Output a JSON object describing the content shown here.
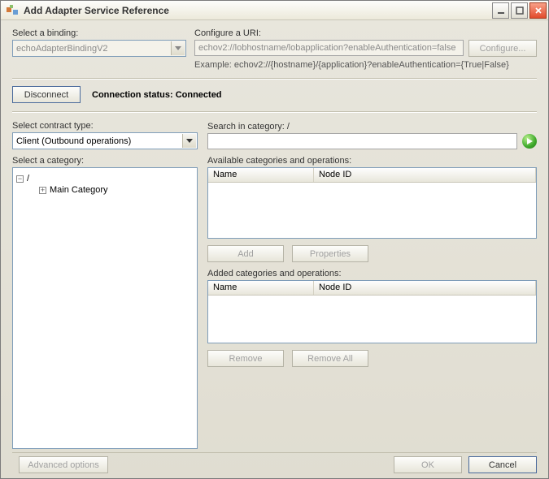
{
  "window": {
    "title": "Add Adapter Service Reference"
  },
  "binding": {
    "label": "Select a binding:",
    "value": "echoAdapterBindingV2"
  },
  "uri": {
    "label": "Configure a URI:",
    "value": "echov2://lobhostname/lobapplication?enableAuthentication=false",
    "configure_btn": "Configure...",
    "example": "Example: echov2://{hostname}/{application}?enableAuthentication={True|False}"
  },
  "connection": {
    "disconnect_btn": "Disconnect",
    "status_label": "Connection status:",
    "status_value": "Connected"
  },
  "contract": {
    "label": "Select contract type:",
    "value": "Client (Outbound operations)"
  },
  "search": {
    "label": "Search in category: /",
    "value": ""
  },
  "category": {
    "label": "Select a category:",
    "root": "/",
    "child": "Main Category"
  },
  "available": {
    "label": "Available categories and operations:",
    "col_name": "Name",
    "col_node": "Node ID",
    "add_btn": "Add",
    "props_btn": "Properties"
  },
  "added": {
    "label": "Added categories and operations:",
    "col_name": "Name",
    "col_node": "Node ID",
    "remove_btn": "Remove",
    "removeall_btn": "Remove All"
  },
  "footer": {
    "advanced_btn": "Advanced options",
    "ok_btn": "OK",
    "cancel_btn": "Cancel"
  }
}
